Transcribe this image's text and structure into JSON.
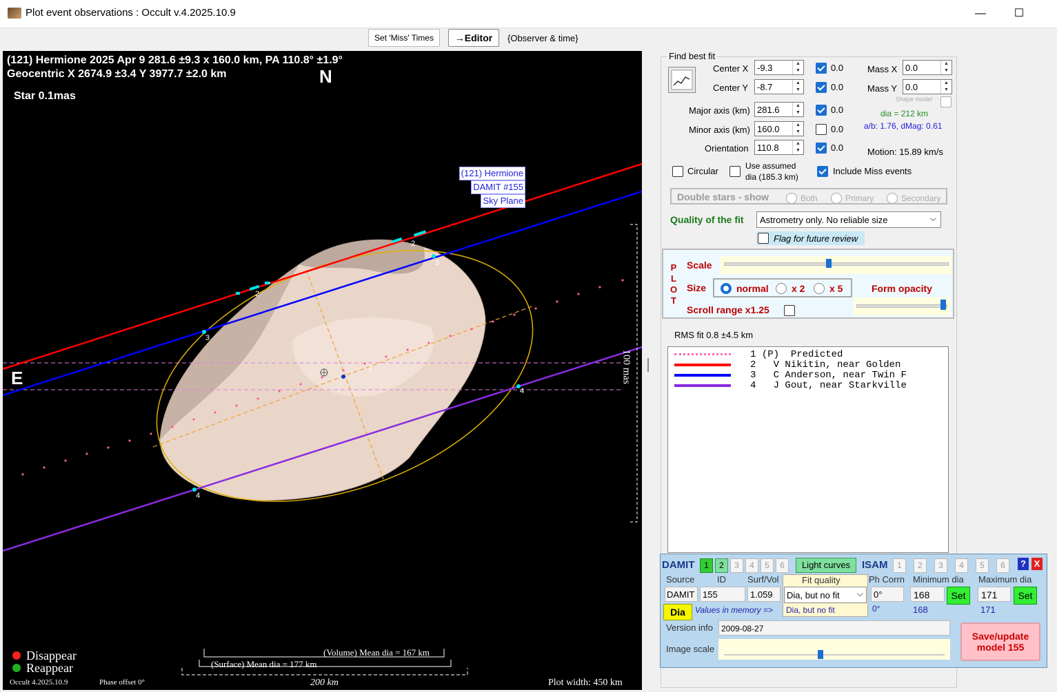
{
  "window": {
    "title": "Plot event observations : Occult v.4.2025.10.9",
    "minimize": "—",
    "maximize": "☐"
  },
  "toolbar": {
    "set_miss": "Set 'Miss' Times",
    "editor": "→Editor",
    "observer_time": "{Observer & time}"
  },
  "plot": {
    "line1": "(121) Hermione  2025 Apr 9   281.6 ±9.3 x 160.0 km, PA 110.8° ±1.9°",
    "line2": "Geocentric  X  2674.9 ±3.4  Y 3977.7 ±2.0 km",
    "north": "N",
    "east": "E",
    "star": "Star 0.1mas",
    "label1": "(121) Hermione",
    "label2": "DAMIT #155",
    "label3": "Sky Plane",
    "scale_mas": "100 mas",
    "disappear": "Disappear",
    "reappear": "Reappear",
    "version": "Occult 4.2025.10.9",
    "phase": "Phase offset 0°",
    "volume_dia": "(Volume) Mean dia = 167 km",
    "surface_dia": "(Surface) Mean dia = 177 km",
    "km200": "200 km",
    "plot_width": "Plot width: 450 km",
    "chord_labels": {
      "c1": "1",
      "c2": "2",
      "c3": "3",
      "c4": "4"
    }
  },
  "fit": {
    "title": "Find best fit",
    "center_x_label": "Center X",
    "center_x": "-9.3",
    "center_x_chk": "0.0",
    "center_y_label": "Center Y",
    "center_y": "-8.7",
    "center_y_chk": "0.0",
    "major_label": "Major axis (km)",
    "major": "281.6",
    "major_chk": "0.0",
    "minor_label": "Minor axis (km)",
    "minor": "160.0",
    "minor_chk": "0.0",
    "orient_label": "Orientation",
    "orient": "110.8",
    "orient_chk": "0.0",
    "mass_x_label": "Mass X",
    "mass_x": "0.0",
    "mass_y_label": "Mass Y",
    "mass_y": "0.0",
    "shape_model": "Shape model",
    "dia": "dia = 212 km",
    "ab": "a/b: 1.76, dMag: 0.61",
    "motion": "Motion: 15.89 km/s",
    "circular": "Circular",
    "use_assumed": "Use assumed",
    "assumed_dia": "dia (185.3 km)",
    "include_miss": "Include Miss events",
    "double_stars": "Double stars - show",
    "both": "Both",
    "primary": "Primary",
    "secondary": "Secondary",
    "quality_label": "Quality of the fit",
    "quality_value": "Astrometry only. No reliable size",
    "flag": "Flag for future review"
  },
  "plotbox": {
    "p": "P",
    "l": "L",
    "o": "O",
    "t": "T",
    "scale": "Scale",
    "size": "Size",
    "normal": "normal",
    "x2": "x 2",
    "x5": "x 5",
    "form_opacity": "Form opacity",
    "scroll_range": "Scroll range x1.25"
  },
  "rms": "RMS fit 0.8 ±4.5 km",
  "legend": [
    {
      "num": "1",
      "text": "(P)  Predicted",
      "color": "#ff69b4"
    },
    {
      "num": "2",
      "text": "  V Nikitin, near Golden",
      "color": "#ff0000"
    },
    {
      "num": "3",
      "text": "  C Anderson, near Twin F",
      "color": "#0000ff"
    },
    {
      "num": "4",
      "text": "  J Gout, near Starkville",
      "color": "#8a2be2"
    }
  ],
  "damit": {
    "title": "DAMIT",
    "nums": [
      "1",
      "2",
      "3",
      "4",
      "5",
      "6"
    ],
    "light_curves": "Light curves",
    "isam": "ISAM",
    "isam_nums": [
      "1",
      "2",
      "3",
      "4",
      "5",
      "6"
    ],
    "help": "?",
    "close": "X",
    "source_h": "Source",
    "id_h": "ID",
    "surf_h": "Surf/Vol",
    "fit_h": "Fit quality",
    "ph_h": "Ph Corrn",
    "min_h": "Minimum dia",
    "max_h": "Maximum dia",
    "source": "DAMIT",
    "id": "155",
    "surf": "1.059",
    "fit": "Dia, but no fit",
    "ph": "0°",
    "min": "168",
    "max": "171",
    "set": "Set",
    "dia_btn": "Dia",
    "values_mem": "Values in memory =>",
    "mem_fit": "Dia, but no fit",
    "mem_ph": "0°",
    "mem_min": "168",
    "mem_max": "171",
    "version_label": "Version info",
    "version": "2009-08-27",
    "image_scale": "Image scale",
    "save": "Save/update\nmodel 155"
  }
}
